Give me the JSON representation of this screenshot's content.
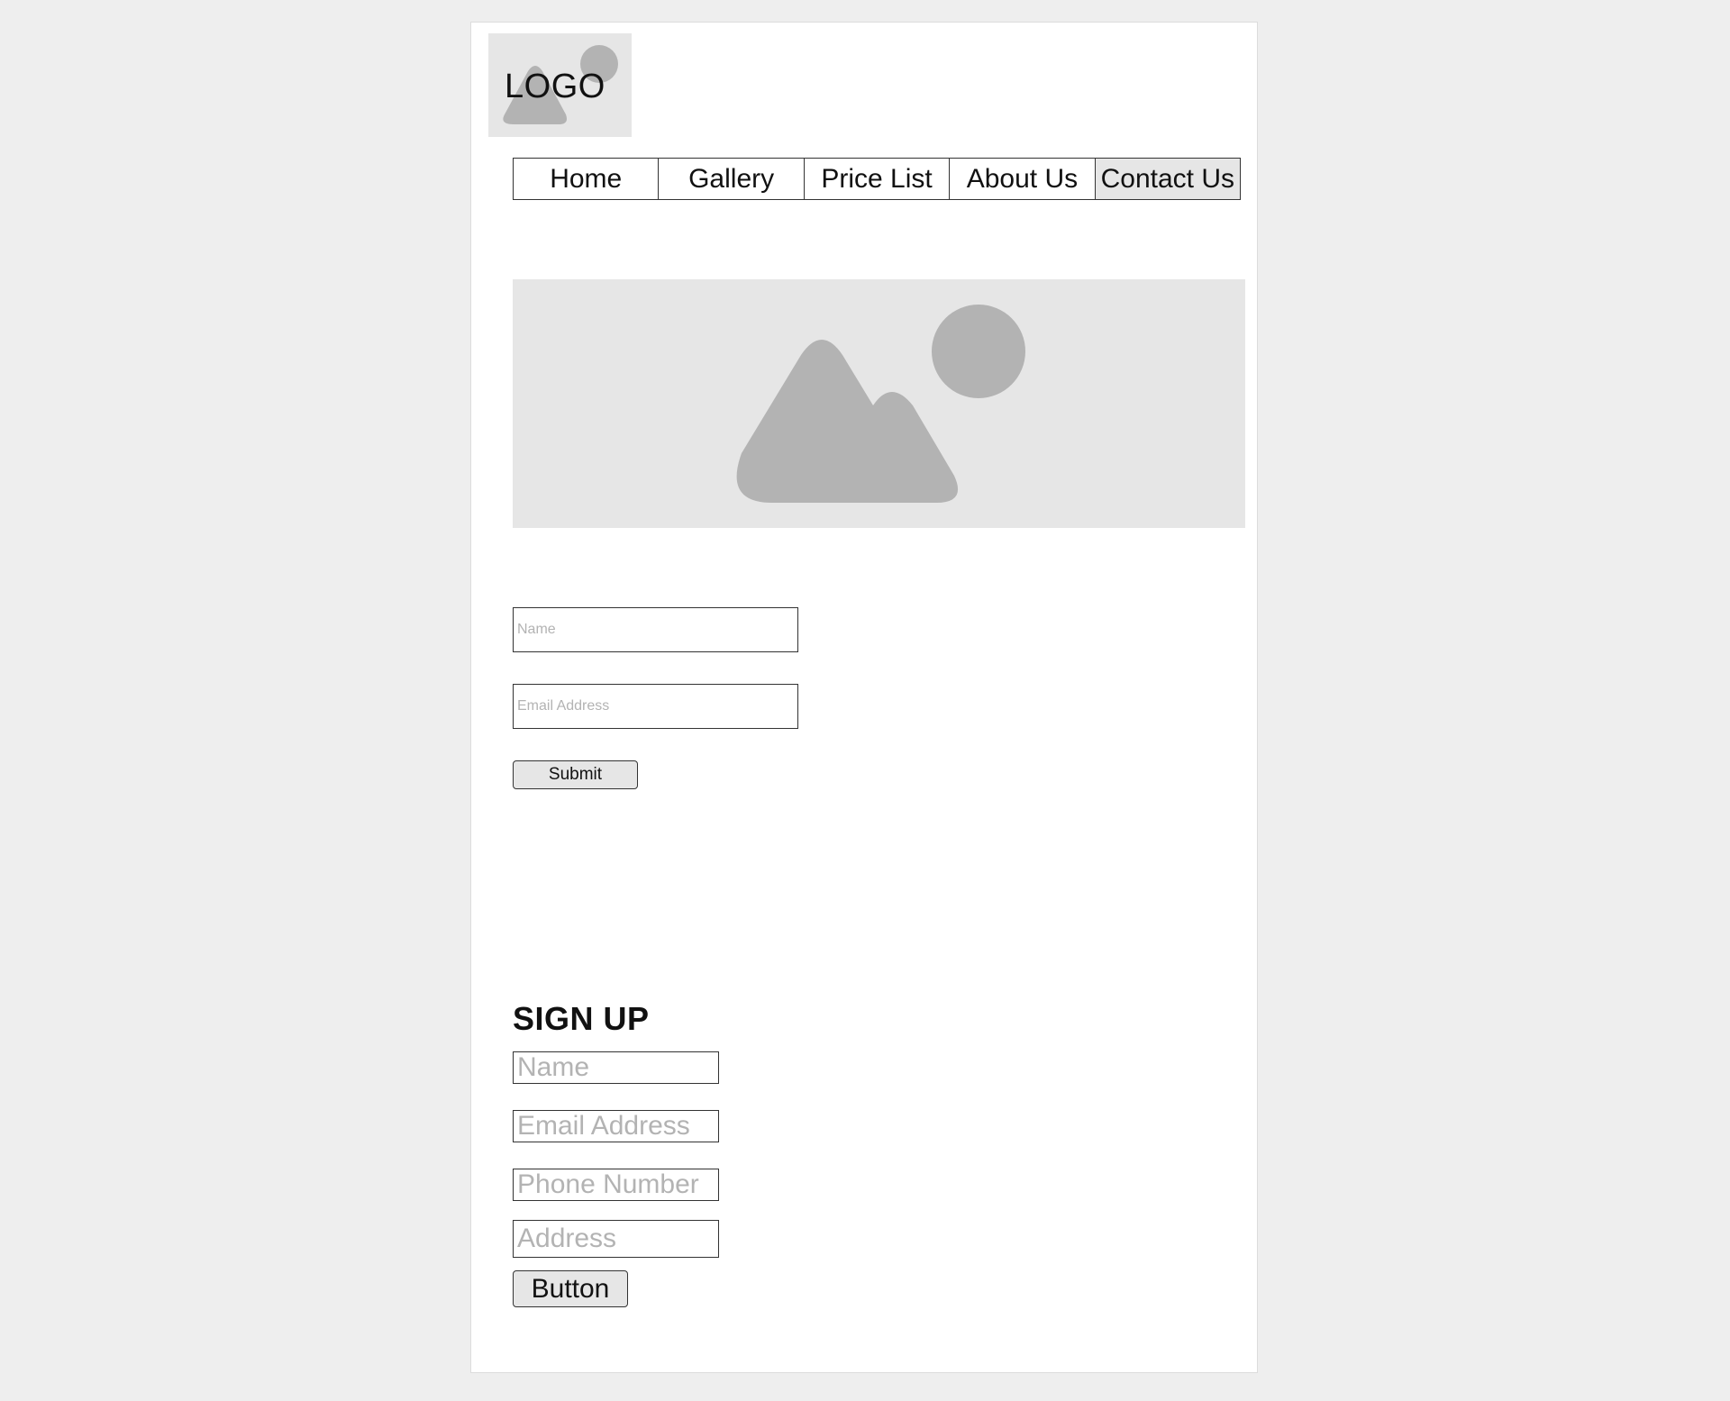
{
  "header": {
    "logo_text": "LOGO"
  },
  "nav": {
    "items": [
      {
        "label": "Home"
      },
      {
        "label": "Gallery"
      },
      {
        "label": "Price List"
      },
      {
        "label": "About Us"
      },
      {
        "label": "Contact Us"
      }
    ],
    "active": "Contact Us"
  },
  "hero": {
    "icon": "image-placeholder-icon"
  },
  "contact_form": {
    "name_placeholder": "Name",
    "email_placeholder": "Email Address",
    "submit_label": "Submit"
  },
  "signup": {
    "title": "SIGN UP",
    "name_placeholder": "Name",
    "email_placeholder": "Email Address",
    "phone_placeholder": "Phone Number",
    "address_placeholder": "Address",
    "button_label": "Button"
  },
  "colors": {
    "background": "#eeeeee",
    "page": "#ffffff",
    "placeholder_fill": "#e6e6e6",
    "placeholder_shape": "#b3b3b3",
    "border": "#333333",
    "placeholder_text": "#b3b3b3"
  }
}
